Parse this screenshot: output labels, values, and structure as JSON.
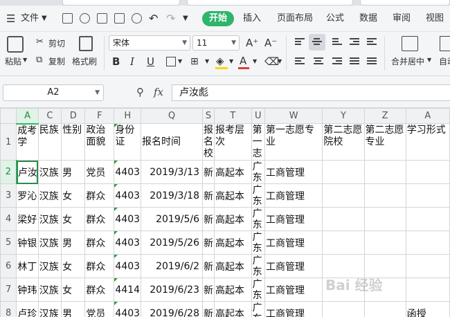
{
  "menubar": {
    "file_label": "文件",
    "start_tab": "开始",
    "tabs": [
      "插入",
      "页面布局",
      "公式",
      "数据",
      "审阅",
      "视图"
    ]
  },
  "ribbon": {
    "paste_label": "粘贴",
    "cut_label": "剪切",
    "copy_label": "复制",
    "format_painter_label": "格式刷",
    "font_name": "宋体",
    "font_size": "11",
    "merge_center_label": "合并居中",
    "auto_label": "自动",
    "bold": "B",
    "italic": "I",
    "underline": "U",
    "font_color_letter": "A",
    "font_color": "#e53935",
    "fill_color": "#f5d90a"
  },
  "formula_bar": {
    "name_box": "A2",
    "fx_label": "fx",
    "content": "卢汝彪"
  },
  "accent": "#2fb56b",
  "sheet": {
    "columns": [
      "A",
      "C",
      "D",
      "F",
      "H",
      "Q",
      "S",
      "T",
      "U",
      "W",
      "Y",
      "Z",
      "A"
    ],
    "header_row": [
      "成考学",
      "民族",
      "性别",
      "政治面貌",
      "身份证",
      "报名时间",
      "报名校",
      "报考层次",
      "第一志",
      "第一志愿专业",
      "第二志愿院校",
      "第二志愿专业",
      "学习形式"
    ],
    "rows": [
      {
        "num": "2",
        "cells": [
          "卢汝",
          "汉族",
          "男",
          "党员",
          "4403",
          "2019/3/13",
          "新",
          "高起本",
          "广东",
          "工商管理",
          "",
          "",
          ""
        ]
      },
      {
        "num": "3",
        "cells": [
          "罗沁",
          "汉族",
          "女",
          "群众",
          "4403",
          "2019/3/18",
          "新",
          "高起本",
          "广东",
          "工商管理",
          "",
          "",
          ""
        ]
      },
      {
        "num": "4",
        "cells": [
          "梁好",
          "汉族",
          "女",
          "群众",
          "4403",
          "2019/5/6",
          "新",
          "高起本",
          "广东",
          "工商管理",
          "",
          "",
          ""
        ]
      },
      {
        "num": "5",
        "cells": [
          "钟银",
          "汉族",
          "男",
          "群众",
          "4403",
          "2019/5/26",
          "新",
          "高起本",
          "广东",
          "工商管理",
          "",
          "",
          ""
        ]
      },
      {
        "num": "6",
        "cells": [
          "林丁",
          "汉族",
          "女",
          "群众",
          "4403",
          "2019/6/2",
          "新",
          "高起本",
          "广东",
          "工商管理",
          "",
          "",
          ""
        ]
      },
      {
        "num": "7",
        "cells": [
          "钟玮",
          "汉族",
          "女",
          "群众",
          "4414",
          "2019/6/23",
          "新",
          "高起本",
          "广东",
          "工商管理",
          "",
          "",
          ""
        ]
      },
      {
        "num": "8",
        "cells": [
          "卢珍",
          "汉族",
          "男",
          "党员",
          "4403",
          "2019/6/28",
          "新",
          "高起本",
          "广东",
          "工商管理",
          "",
          "",
          "函授"
        ]
      }
    ]
  },
  "row1_num": "1",
  "watermark": "Bai 经验"
}
